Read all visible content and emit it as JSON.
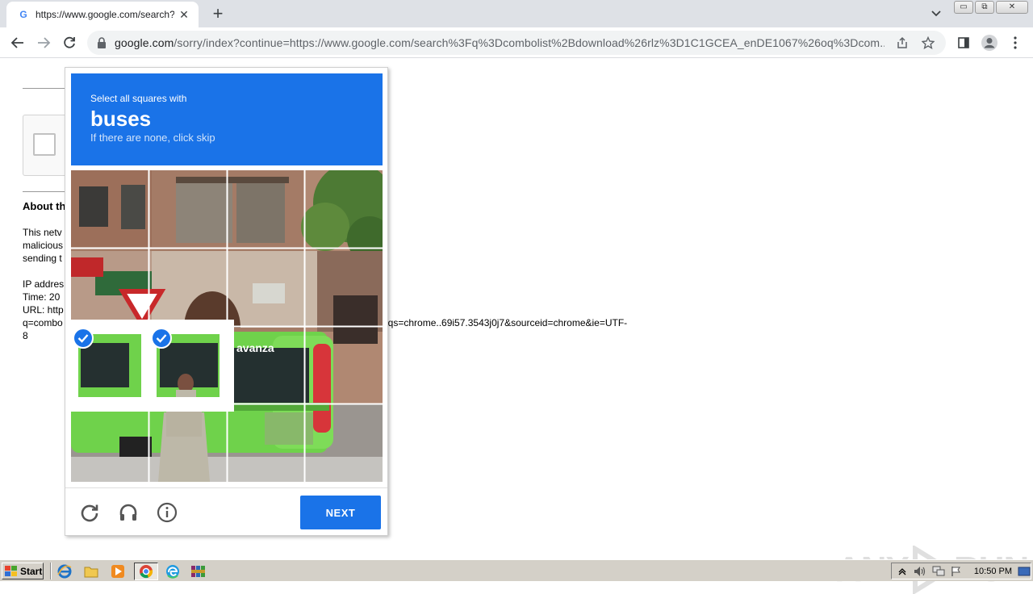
{
  "browser": {
    "tab_title": "https://www.google.com/search?q=",
    "tab_favicon": "G",
    "url_host": "google.com",
    "url_rest": "/sorry/index?continue=https://www.google.com/search%3Fq%3Dcombolist%2Bdownload%26rlz%3D1C1GCEA_enDE1067%26oq%3Dcom..."
  },
  "window_buttons": {
    "minimize": "▭",
    "restore": "⧉",
    "close": "✕"
  },
  "page": {
    "about_title": "About th",
    "lines1": [
      "This netv",
      "malicious",
      "sending t"
    ],
    "lines2": [
      "IP addres",
      "Time: 20",
      "URL: http",
      "q=combo"
    ],
    "line2_tail": "aqs=chrome..69i57.3543j0j7&sourceid=chrome&ie=UTF-",
    "last_line": "8"
  },
  "captcha": {
    "select_text": "Select all squares with",
    "keyword": "buses",
    "hint": "If there are none, click skip",
    "next_label": "NEXT",
    "selected_tiles": [
      [
        2,
        0
      ],
      [
        2,
        1
      ]
    ]
  },
  "watermark": {
    "text1": "ANY",
    "text2": "RUN"
  },
  "taskbar": {
    "start_label": "Start",
    "clock": "10:50 PM",
    "icons": [
      "ie-icon",
      "folder-icon",
      "media-player-icon",
      "chrome-icon",
      "edge-icon",
      "winrar-icon"
    ]
  },
  "colors": {
    "accent": "#1a73e8",
    "chrome_bg": "#dee1e6",
    "taskbar": "#d4d0c8"
  }
}
